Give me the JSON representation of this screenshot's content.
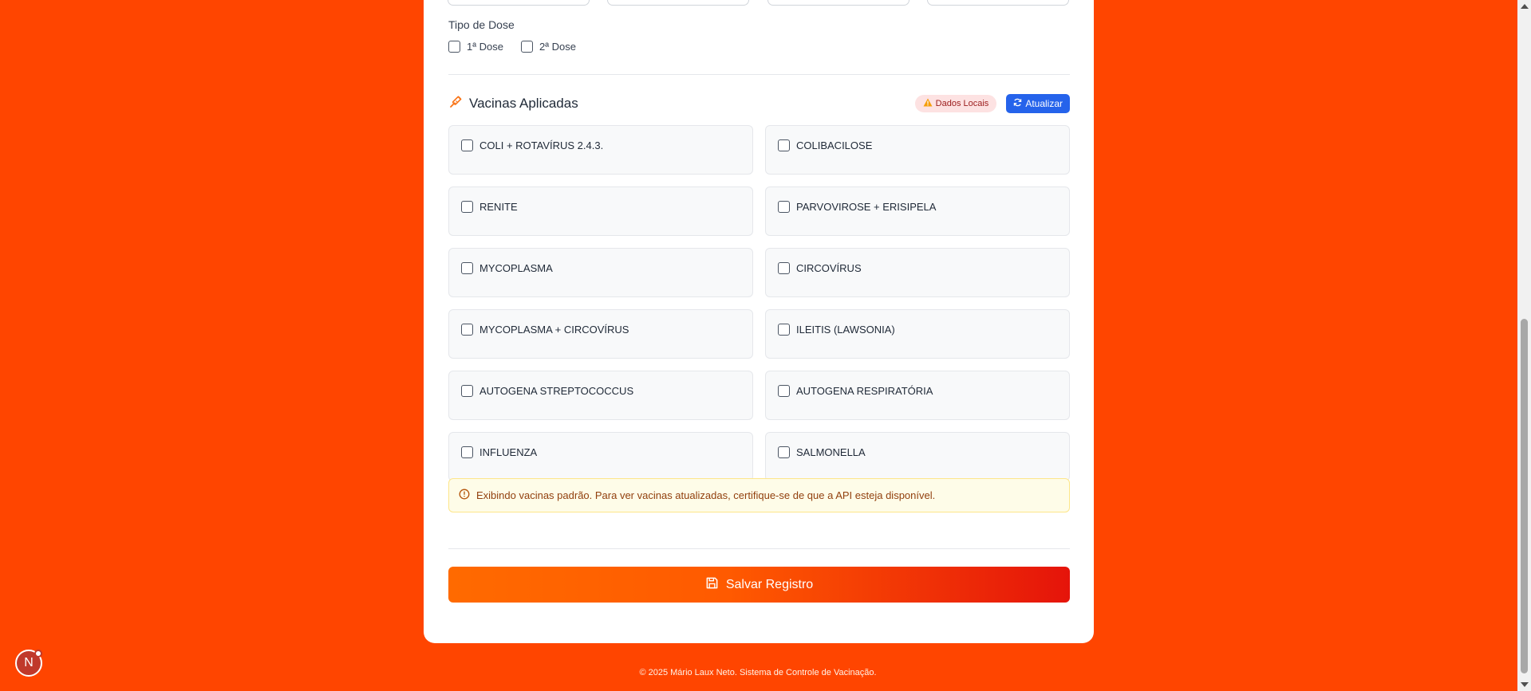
{
  "dose": {
    "label": "Tipo de Dose",
    "options": [
      "1ª Dose",
      "2ª Dose"
    ]
  },
  "section": {
    "title": "Vacinas Aplicadas",
    "badge": "Dados Locais",
    "refresh_label": "Atualizar"
  },
  "vaccines": [
    "COLI + ROTAVÍRUS 2.4.3.",
    "COLIBACILOSE",
    "RENITE",
    "PARVOVIROSE + ERISIPELA",
    "MYCOPLASMA",
    "CIRCOVÍRUS",
    "MYCOPLASMA + CIRCOVÍRUS",
    "ILEITIS (LAWSONIA)",
    "AUTOGENA STREPTOCOCCUS",
    "AUTOGENA RESPIRATÓRIA",
    "INFLUENZA",
    "SALMONELLA"
  ],
  "notice": "Exibindo vacinas padrão. Para ver vacinas atualizadas, certifique-se de que a API esteja disponível.",
  "save_label": "Salvar Registro",
  "footer": "© 2025 Mário Laux Neto. Sistema de Controle de Vacinação.",
  "dev_badge": "N",
  "colors": {
    "background": "#ff4500",
    "accent_blue": "#2563eb",
    "save_gradient_start": "#ff6a00",
    "save_gradient_end": "#e5140a"
  },
  "icons": {
    "section": "syringe-icon",
    "badge": "warning-icon",
    "refresh": "refresh-icon",
    "notice": "info-icon",
    "save": "save-icon"
  }
}
